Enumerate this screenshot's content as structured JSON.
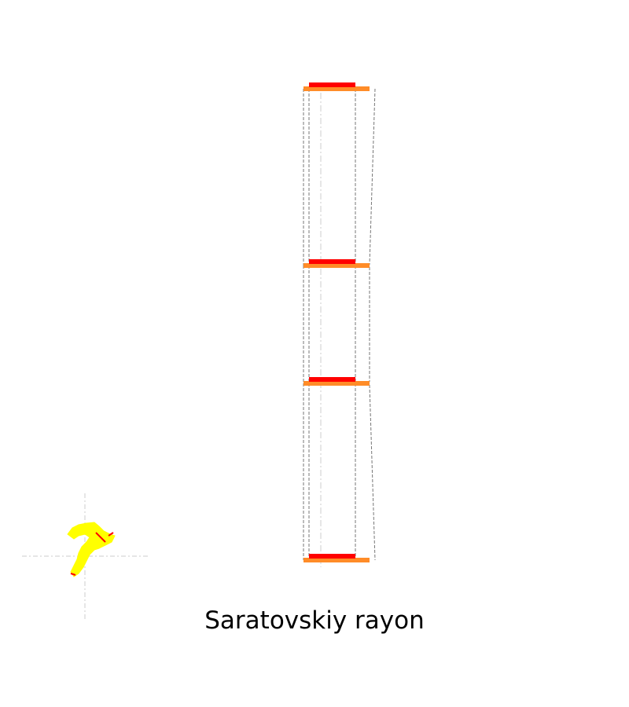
{
  "chart_data": {
    "type": "bar",
    "title": "Saratovskiy rayon",
    "levels": 4,
    "series": [
      {
        "color": "#ff0000"
      },
      {
        "color": "#ff8c28"
      }
    ],
    "guide_color": "#777777",
    "axis_color": "#cccccc",
    "map_colors": {
      "fill": "#ffff00",
      "edge": "#ff0000",
      "crosshair": "#cccccc"
    }
  }
}
